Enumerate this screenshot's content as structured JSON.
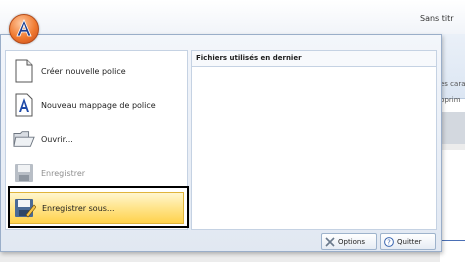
{
  "window": {
    "title": "Sans titr"
  },
  "ribbon": {
    "partial_label_1": "es cara",
    "partial_label_2": "pprim"
  },
  "app_menu": {
    "items": [
      {
        "label": "Créer nouvelle police",
        "icon": "new-document-icon",
        "enabled": true
      },
      {
        "label": "Nouveau mappage de police",
        "icon": "font-mapping-icon",
        "enabled": true
      },
      {
        "label": "Ouvrir...",
        "icon": "open-folder-icon",
        "enabled": true
      },
      {
        "label": "Enregistrer",
        "icon": "save-disk-icon",
        "enabled": false
      },
      {
        "label": "Enregistrer sous...",
        "icon": "save-as-icon",
        "enabled": true,
        "highlighted": true
      }
    ],
    "recent_files": {
      "header": "Fichiers utilisés en dernier",
      "items": []
    },
    "footer": {
      "options_label": "Options",
      "quit_label": "Quitter"
    }
  },
  "colors": {
    "highlight": "#ffd24d",
    "menu_border": "#9aaec9",
    "orb": "#f07a30"
  }
}
